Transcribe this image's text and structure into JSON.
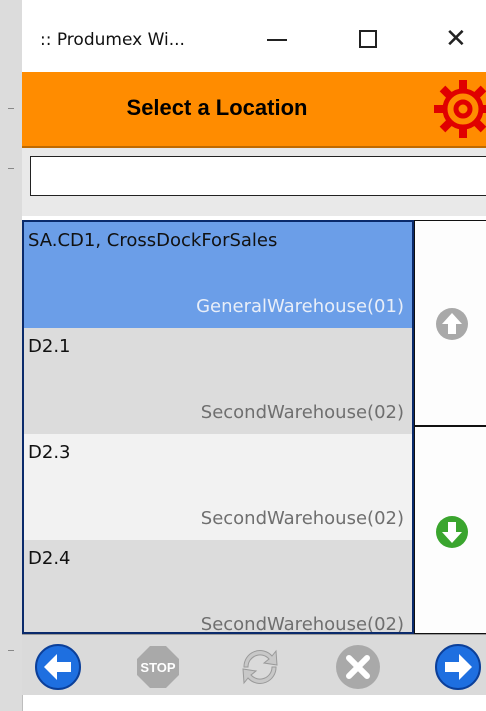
{
  "window": {
    "title": ":: Produmex Wi...",
    "min_label": "—",
    "max_label": "☐",
    "close_label": "✕"
  },
  "header": {
    "title": "Select a Location",
    "settings_icon": "gear-icon",
    "accent": "#ff8c00"
  },
  "search": {
    "value": "",
    "placeholder": ""
  },
  "locations": [
    {
      "code": "SA.CD1, CrossDockForSales",
      "warehouse": "GeneralWarehouse(01)",
      "state": "selected"
    },
    {
      "code": "D2.1",
      "warehouse": "SecondWarehouse(02)",
      "state": "alt"
    },
    {
      "code": "D2.3",
      "warehouse": "SecondWarehouse(02)",
      "state": "plain"
    },
    {
      "code": "D2.4",
      "warehouse": "SecondWarehouse(02)",
      "state": "alt"
    }
  ],
  "scroll": {
    "up_icon": "arrow-up-icon",
    "up_enabled": false,
    "down_icon": "arrow-down-icon",
    "down_enabled": true
  },
  "footer": {
    "back_icon": "arrow-left-icon",
    "stop_label": "STOP",
    "refresh_icon": "refresh-icon",
    "cancel_icon": "cancel-icon",
    "next_icon": "arrow-right-icon"
  },
  "colors": {
    "selected_row": "#6b9ee8",
    "nav_blue": "#1e6fe0",
    "scroll_down_green": "#3aa52e",
    "disabled_gray": "#a9a9a9"
  }
}
